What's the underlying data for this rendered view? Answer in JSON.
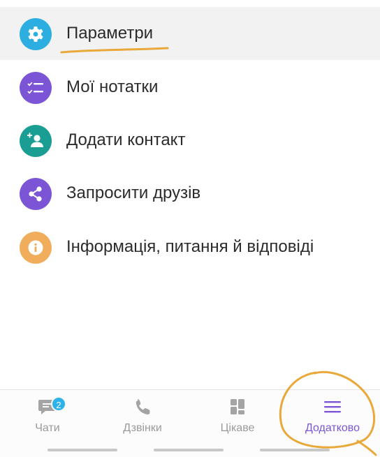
{
  "menu": {
    "items": [
      {
        "label": "Параметри",
        "icon": "gear-icon",
        "color": "#2daee0"
      },
      {
        "label": "Мої нотатки",
        "icon": "checklist-icon",
        "color": "#7b55d6"
      },
      {
        "label": "Додати контакт",
        "icon": "add-contact-icon",
        "color": "#1a9e94"
      },
      {
        "label": "Запросити друзів",
        "icon": "share-icon",
        "color": "#7b55d6"
      },
      {
        "label": "Інформація, питання й відповіді",
        "icon": "info-icon",
        "color": "#f0ae5c"
      }
    ]
  },
  "bottom_nav": {
    "tabs": [
      {
        "label": "Чати",
        "icon": "chat-icon",
        "badge": "2"
      },
      {
        "label": "Дзвінки",
        "icon": "phone-icon"
      },
      {
        "label": "Цікаве",
        "icon": "grid-icon"
      },
      {
        "label": "Додатково",
        "icon": "menu-icon",
        "active": true
      }
    ]
  },
  "colors": {
    "accent": "#7b55d6",
    "badge": "#2db3ea",
    "annotation": "#e9a93a"
  }
}
